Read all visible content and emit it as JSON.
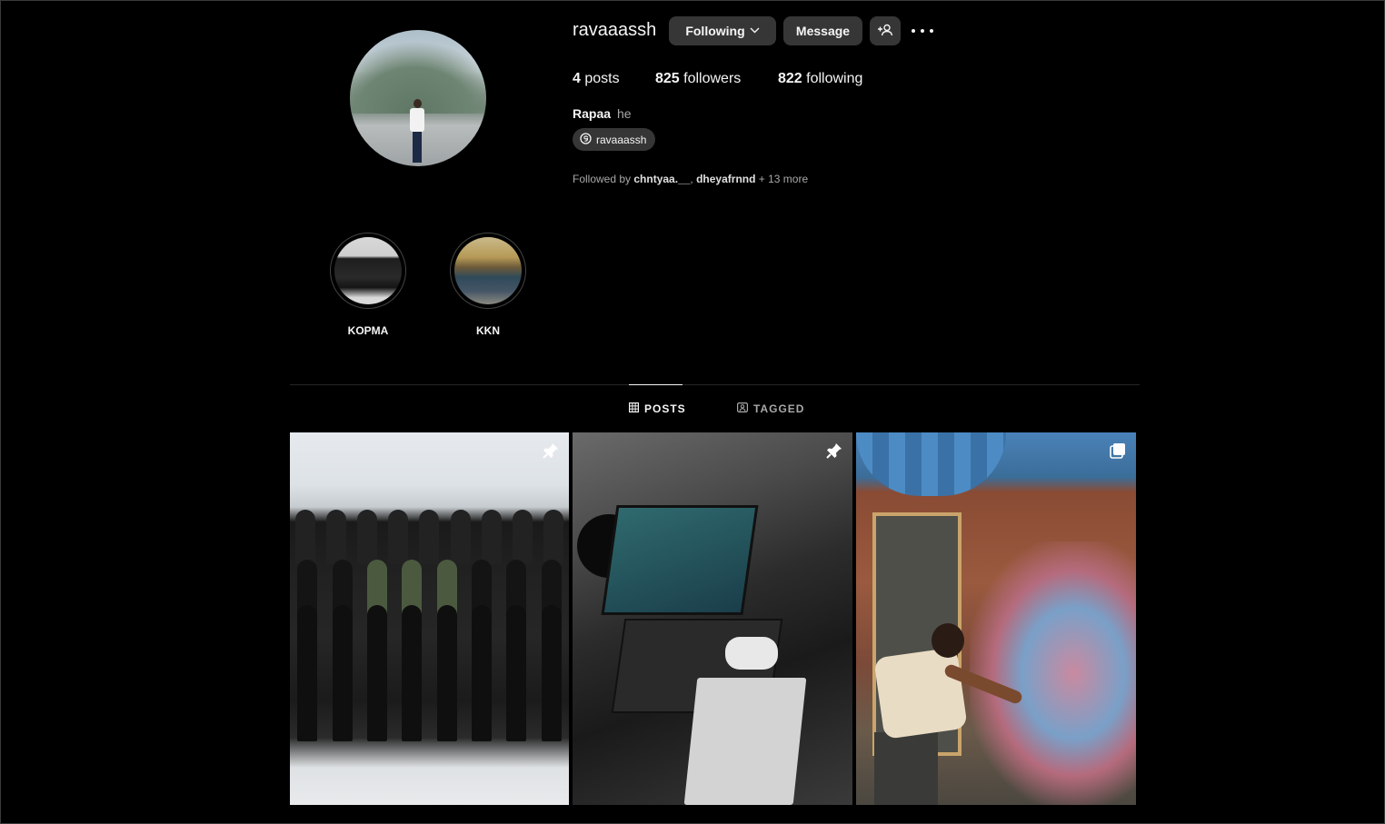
{
  "profile": {
    "username": "ravaaassh",
    "following_button": "Following",
    "message_button": "Message",
    "stats": {
      "posts_count": "4",
      "posts_label": " posts",
      "followers_count": "825",
      "followers_label": " followers",
      "following_count": "822",
      "following_label": " following"
    },
    "full_name": "Rapaa",
    "pronouns": "he",
    "threads_handle": "ravaaassh",
    "followed_by": {
      "prefix": "Followed by ",
      "user1": "chntyaa.__",
      "separator": ", ",
      "user2": "dheyafrnnd",
      "suffix": " + 13 more"
    }
  },
  "highlights": [
    {
      "label": "KOPMA"
    },
    {
      "label": "KKN"
    }
  ],
  "tabs": {
    "posts": "POSTS",
    "tagged": "TAGGED"
  },
  "posts": [
    {
      "pinned": true,
      "icon": "pin-icon"
    },
    {
      "pinned": true,
      "icon": "pin-icon"
    },
    {
      "pinned": false,
      "icon": "carousel-icon"
    }
  ],
  "colors": {
    "background": "#000000",
    "button_bg": "#363636",
    "muted_text": "#a8a8a8",
    "divider": "#262626"
  }
}
